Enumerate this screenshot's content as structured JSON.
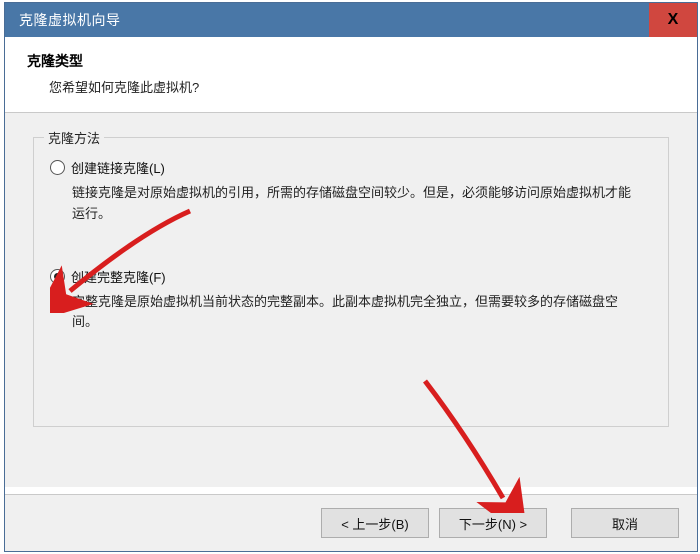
{
  "window": {
    "title": "克隆虚拟机向导",
    "close_label": "X"
  },
  "header": {
    "heading": "克隆类型",
    "subheading": "您希望如何克隆此虚拟机?"
  },
  "group": {
    "legend": "克隆方法",
    "options": {
      "linked": {
        "label": "创建链接克隆(L)",
        "description": "链接克隆是对原始虚拟机的引用，所需的存储磁盘空间较少。但是，必须能够访问原始虚拟机才能运行。"
      },
      "full": {
        "label": "创建完整克隆(F)",
        "description": "完整克隆是原始虚拟机当前状态的完整副本。此副本虚拟机完全独立，但需要较多的存储磁盘空间。"
      }
    }
  },
  "footer": {
    "back": "< 上一步(B)",
    "next": "下一步(N) >",
    "cancel": "取消"
  }
}
